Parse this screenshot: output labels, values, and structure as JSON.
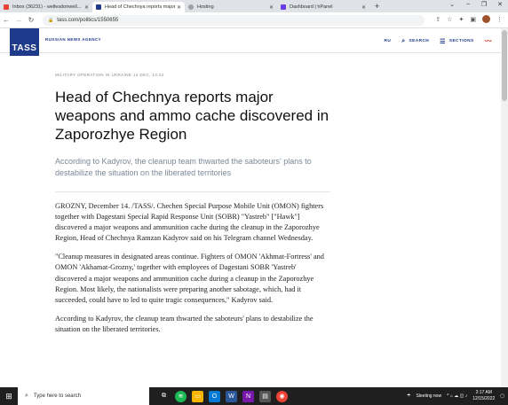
{
  "browser": {
    "tabs": [
      {
        "title": "Inbox (36231) - wellesdonwell...",
        "icon": "gmail-icon",
        "color": "#ea4335",
        "active": false
      },
      {
        "title": "Head of Chechnya reports major",
        "icon": "tass-icon",
        "color": "#1e3a8a",
        "active": true
      },
      {
        "title": "Hosting",
        "icon": "hosting-icon",
        "color": "#9aa0a6",
        "active": false
      },
      {
        "title": "Dashboard | hPanel",
        "icon": "hpanel-icon",
        "color": "#673de6",
        "active": false
      }
    ],
    "url": "tass.com/politics/1550655"
  },
  "site": {
    "logo": "TASS",
    "agency": "RUSSIAN NEWS AGENCY",
    "nav": {
      "lang": "RU",
      "search": "SEARCH",
      "sections": "SECTIONS"
    }
  },
  "article": {
    "meta": "MILITARY OPERATION IN UKRAINE   14 DEC, 13:22",
    "title": "Head of Chechnya reports major weapons and ammo cache discovered in Zaporozhye Region",
    "lead": "According to Kadyrov, the cleanup team thwarted the saboteurs' plans to destabilize the situation on the liberated territories",
    "paragraphs": [
      "GROZNY, December 14. /TASS/. Chechen Special Purpose Mobile Unit (OMON) fighters together with Dagestani Special Rapid Response Unit (SOBR) \"Yastreb\" [\"Hawk\"] discovered a major weapons and ammunition cache during the cleanup in the Zaporozhye Region, Head of Chechnya Ramzan Kadyrov said on his Telegram channel Wednesday.",
      "\"Cleanup measures in designated areas continue. Fighters of OMON 'Akhmat-Fortress' and OMON 'Akhamat-Grozny,' together with employees of Dagestani SOBR 'Yastreb' discovered a major weapons and ammunition cache during a cleanup in the Zaporozhye Region. Most likely, the nationalists were preparing another sabotage, which, had it succeeded, could have to led to quite tragic consequences,\" Kadyrov said.",
      "According to Kadyrov, the cleanup team thwarted the saboteurs' plans to destabilize the situation on the liberated territories."
    ]
  },
  "taskbar": {
    "search_placeholder": "Type here to search",
    "weather": "Sleeting now",
    "time": "2:17 AM",
    "date": "12/15/2022"
  }
}
